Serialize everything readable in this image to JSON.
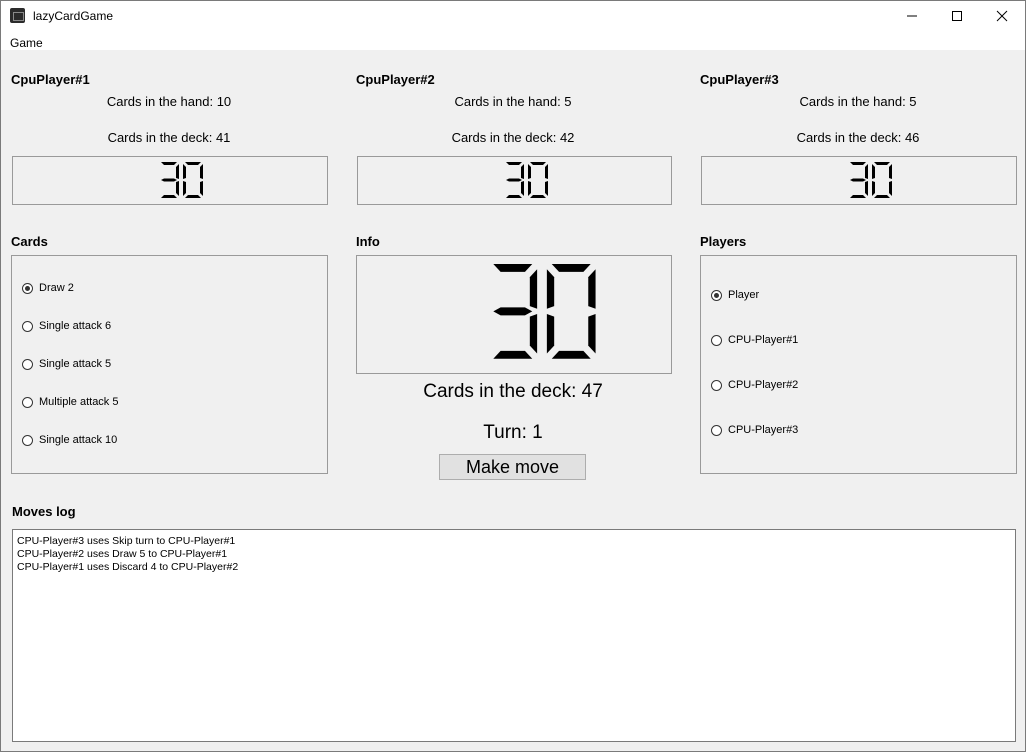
{
  "window": {
    "title": "lazyCardGame",
    "menu": [
      "Game"
    ]
  },
  "cpu_players": [
    {
      "name": "CpuPlayer#1",
      "hand_text": "Cards in the hand: 10",
      "deck_text": "Cards in the deck: 41",
      "display": "30"
    },
    {
      "name": "CpuPlayer#2",
      "hand_text": "Cards in the hand: 5",
      "deck_text": "Cards in the deck: 42",
      "display": "30"
    },
    {
      "name": "CpuPlayer#3",
      "hand_text": "Cards in the hand: 5",
      "deck_text": "Cards in the deck: 46",
      "display": "30"
    }
  ],
  "cards": {
    "label": "Cards",
    "items": [
      "Draw 2",
      "Single attack 6",
      "Single attack 5",
      "Multiple attack 5",
      "Single attack 10"
    ],
    "selected_index": 0
  },
  "info": {
    "label": "Info",
    "display": "30",
    "deck_text": "Cards in the deck: 47",
    "turn_text": "Turn: 1",
    "button_label": "Make move"
  },
  "players": {
    "label": "Players",
    "items": [
      "Player",
      "CPU-Player#1",
      "CPU-Player#2",
      "CPU-Player#3"
    ],
    "selected_index": 0
  },
  "moves_log": {
    "label": "Moves log",
    "lines": [
      "CPU-Player#3 uses Skip turn to CPU-Player#1",
      "CPU-Player#2 uses Draw 5 to CPU-Player#1",
      "CPU-Player#1 uses Discard 4 to CPU-Player#2"
    ]
  },
  "icons": {
    "minimize": "minimize-icon",
    "maximize": "maximize-icon",
    "close": "close-icon",
    "app": "app-icon"
  }
}
